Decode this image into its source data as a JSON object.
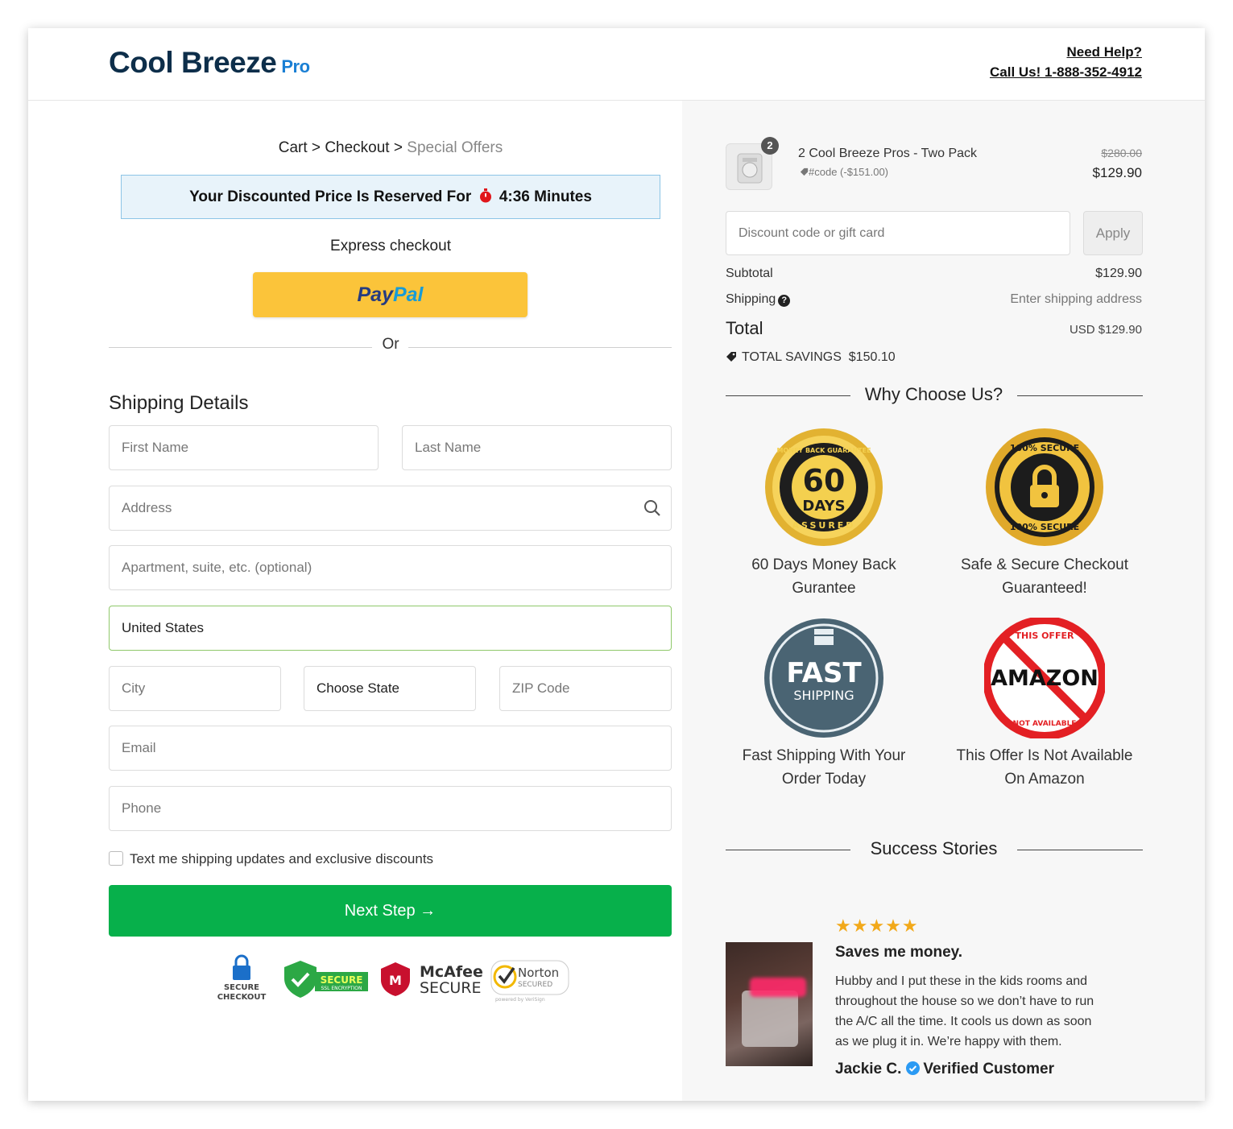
{
  "header": {
    "logo": "Cool Breeze",
    "logo_suffix": "Pro",
    "help_line1": "Need Help?",
    "help_line2": "Call Us! 1-888-352-4912"
  },
  "breadcrumb": {
    "cart": "Cart",
    "sep": ">",
    "checkout": "Checkout",
    "offers": "Special Offers"
  },
  "timer": {
    "text": "Your Discounted Price Is Reserved For",
    "time": "4:36 Minutes"
  },
  "express": {
    "title": "Express checkout",
    "paypal_a": "Pay",
    "paypal_b": "Pal",
    "or": "Or"
  },
  "shipping": {
    "title": "Shipping Details",
    "first_name": "First Name",
    "last_name": "Last Name",
    "address": "Address",
    "apartment": "Apartment, suite, etc. (optional)",
    "country": "United States",
    "city": "City",
    "state": "Choose State",
    "zip": "ZIP Code",
    "email": "Email",
    "phone": "Phone",
    "sms_label": "Text me shipping updates and exclusive discounts",
    "next_button": "Next Step →"
  },
  "trust_badges": {
    "secure_checkout": "SECURE CHECKOUT",
    "secure": "SECURE",
    "ssl": "SSL ENCRYPTION",
    "mcafee_1": "McAfee",
    "mcafee_2": "SECURE",
    "norton_1": "Norton",
    "norton_2": "SECURED",
    "norton_3": "powered by VeriSign"
  },
  "order": {
    "qty": "2",
    "name": "2 Cool Breeze Pros - Two Pack",
    "code": "#code (-$151.00)",
    "old_price": "$280.00",
    "price": "$129.90",
    "discount_placeholder": "Discount code or gift card",
    "apply": "Apply",
    "subtotal_label": "Subtotal",
    "subtotal": "$129.90",
    "shipping_label": "Shipping",
    "shipping_value": "Enter shipping address",
    "total_label": "Total",
    "total": "USD $129.90",
    "savings_label": "TOTAL SAVINGS",
    "savings": "$150.10"
  },
  "why": {
    "title": "Why Choose Us?",
    "features": [
      {
        "line1": "60 Days Money Back",
        "line2": "Gurantee",
        "badge_a": "60",
        "badge_b": "DAYS",
        "ring": "MONEY BACK GUARANTEE",
        "ring2": "ASSURED"
      },
      {
        "line1": "Safe & Secure Checkout",
        "line2": "Guaranteed!",
        "ring": "100% SECURE",
        "ring2": "100% SECURE"
      },
      {
        "line1": "Fast Shipping With Your",
        "line2": "Order Today",
        "badge_a": "FAST",
        "badge_b": "SHIPPING"
      },
      {
        "line1": "This Offer Is Not Available",
        "line2": "On Amazon",
        "badge_a": "AMAZON",
        "ring": "THIS OFFER",
        "ring2": "NOT AVAILABLE"
      }
    ]
  },
  "stories": {
    "title": "Success Stories",
    "stars": "★★★★★",
    "review_title": "Saves me money.",
    "review_lines": [
      "Hubby and I put these in the kids rooms and",
      "throughout the house so we don’t have to run",
      "the A/C all the time. It cools us down as soon",
      "as we plug it in. We’re happy with them."
    ],
    "author": "Jackie C.",
    "verified": "Verified Customer"
  },
  "colors": {
    "accent_green": "#07b04b",
    "paypal_yellow": "#fbc43a",
    "logo_navy": "#0d2e4a",
    "logo_blue": "#1a7fd4"
  }
}
